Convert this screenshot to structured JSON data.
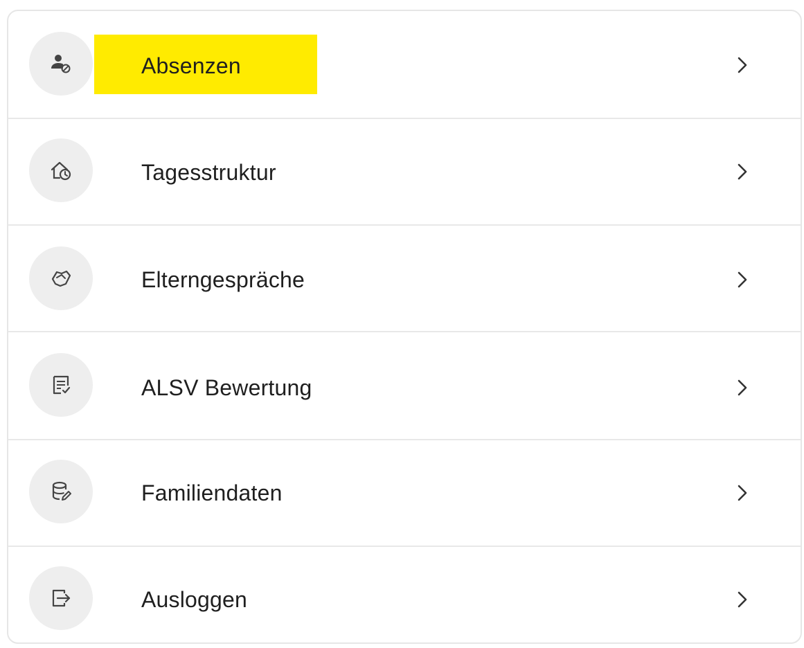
{
  "menu": {
    "items": [
      {
        "label": "Absenzen",
        "icon": "user-absent-icon",
        "highlighted": true
      },
      {
        "label": "Tagesstruktur",
        "icon": "home-clock-icon",
        "highlighted": false
      },
      {
        "label": "Elterngespräche",
        "icon": "handshake-icon",
        "highlighted": false
      },
      {
        "label": "ALSV Bewertung",
        "icon": "checklist-icon",
        "highlighted": false
      },
      {
        "label": "Familiendaten",
        "icon": "database-edit-icon",
        "highlighted": false
      },
      {
        "label": "Ausloggen",
        "icon": "logout-icon",
        "highlighted": false
      }
    ]
  },
  "colors": {
    "highlight": "#ffeb00",
    "icon_bg": "#eeeeee",
    "text": "#1f1f1f",
    "divider": "#e8e8e8",
    "border": "#e6e6e6"
  }
}
